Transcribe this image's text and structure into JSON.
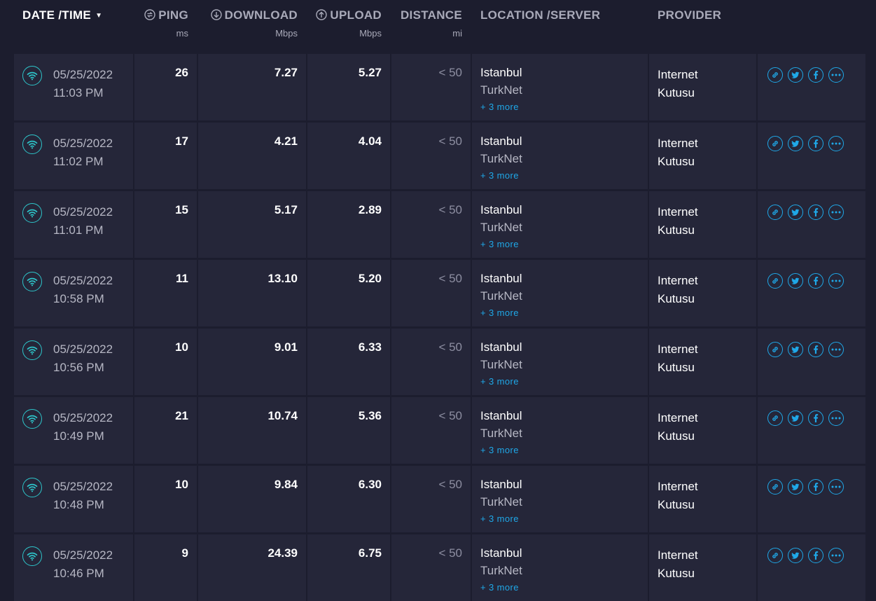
{
  "header": {
    "datetime": "DATE /TIME",
    "ping": "PING",
    "ping_unit": "ms",
    "download": "DOWNLOAD",
    "download_unit": "Mbps",
    "upload": "UPLOAD",
    "upload_unit": "Mbps",
    "distance": "DISTANCE",
    "distance_unit": "mi",
    "location": "LOCATION /SERVER",
    "provider": "PROVIDER"
  },
  "rows": [
    {
      "date": "05/25/2022",
      "time": "11:03 PM",
      "ping": "26",
      "download": "7.27",
      "upload": "5.27",
      "distance": "< 50",
      "city": "Istanbul",
      "isp": "TurkNet",
      "more": "+ 3 more",
      "provider_line1": "Internet",
      "provider_line2": "Kutusu"
    },
    {
      "date": "05/25/2022",
      "time": "11:02 PM",
      "ping": "17",
      "download": "4.21",
      "upload": "4.04",
      "distance": "< 50",
      "city": "Istanbul",
      "isp": "TurkNet",
      "more": "+ 3 more",
      "provider_line1": "Internet",
      "provider_line2": "Kutusu"
    },
    {
      "date": "05/25/2022",
      "time": "11:01 PM",
      "ping": "15",
      "download": "5.17",
      "upload": "2.89",
      "distance": "< 50",
      "city": "Istanbul",
      "isp": "TurkNet",
      "more": "+ 3 more",
      "provider_line1": "Internet",
      "provider_line2": "Kutusu"
    },
    {
      "date": "05/25/2022",
      "time": "10:58 PM",
      "ping": "11",
      "download": "13.10",
      "upload": "5.20",
      "distance": "< 50",
      "city": "Istanbul",
      "isp": "TurkNet",
      "more": "+ 3 more",
      "provider_line1": "Internet",
      "provider_line2": "Kutusu"
    },
    {
      "date": "05/25/2022",
      "time": "10:56 PM",
      "ping": "10",
      "download": "9.01",
      "upload": "6.33",
      "distance": "< 50",
      "city": "Istanbul",
      "isp": "TurkNet",
      "more": "+ 3 more",
      "provider_line1": "Internet",
      "provider_line2": "Kutusu"
    },
    {
      "date": "05/25/2022",
      "time": "10:49 PM",
      "ping": "21",
      "download": "10.74",
      "upload": "5.36",
      "distance": "< 50",
      "city": "Istanbul",
      "isp": "TurkNet",
      "more": "+ 3 more",
      "provider_line1": "Internet",
      "provider_line2": "Kutusu"
    },
    {
      "date": "05/25/2022",
      "time": "10:48 PM",
      "ping": "10",
      "download": "9.84",
      "upload": "6.30",
      "distance": "< 50",
      "city": "Istanbul",
      "isp": "TurkNet",
      "more": "+ 3 more",
      "provider_line1": "Internet",
      "provider_line2": "Kutusu"
    },
    {
      "date": "05/25/2022",
      "time": "10:46 PM",
      "ping": "9",
      "download": "24.39",
      "upload": "6.75",
      "distance": "< 50",
      "city": "Istanbul",
      "isp": "TurkNet",
      "more": "+ 3 more",
      "provider_line1": "Internet",
      "provider_line2": "Kutusu"
    }
  ],
  "icons": {
    "connection": "wifi-icon",
    "actions": [
      "link-icon",
      "twitter-icon",
      "facebook-icon",
      "more-icon"
    ]
  },
  "colors": {
    "background": "#1c1d2e",
    "row": "#252639",
    "wifi_accent": "#2ec4c9",
    "link_accent": "#1fa8e8"
  }
}
